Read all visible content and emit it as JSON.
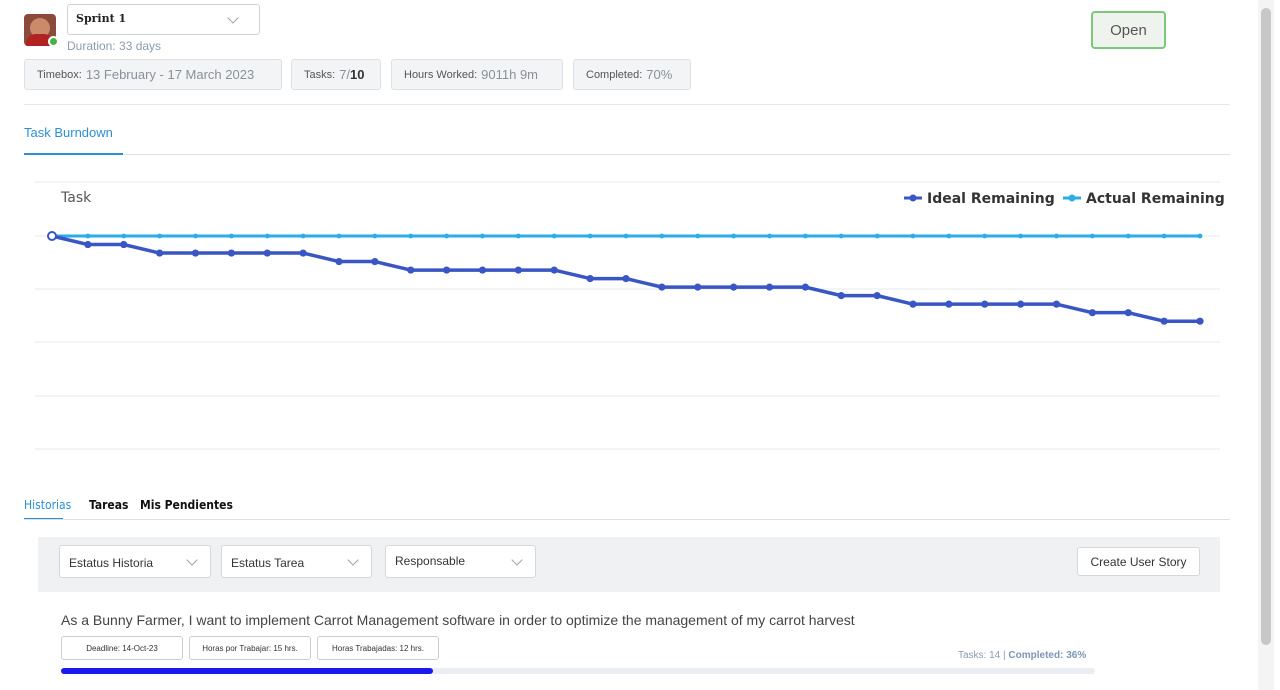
{
  "header": {
    "sprint_select_label": "Sprint 1",
    "duration": "Duration: 33 days",
    "status_button": "Open"
  },
  "stats": [
    {
      "key": "Timebox:",
      "value": "13 February - 17 March 2023"
    },
    {
      "key": "Tasks:",
      "value_prefix": "7/",
      "value_bold": "10"
    },
    {
      "key": "Hours Worked:",
      "value": "9011h 9m"
    },
    {
      "key": "Completed:",
      "value": "70%"
    }
  ],
  "tabs": {
    "burndown": "Task Burndown"
  },
  "chart_data": {
    "type": "line",
    "title": "Task",
    "legend_placement": "top-right",
    "grid": true,
    "x_count": 33,
    "ylim": [
      0,
      10
    ],
    "series": [
      {
        "name": "Ideal Remaining",
        "color": "#3a55c4",
        "values": [
          10,
          9.6,
          9.6,
          9.2,
          9.2,
          9.2,
          9.2,
          9.2,
          8.8,
          8.8,
          8.4,
          8.4,
          8.4,
          8.4,
          8.4,
          8.0,
          8.0,
          7.6,
          7.6,
          7.6,
          7.6,
          7.6,
          7.2,
          7.2,
          6.8,
          6.8,
          6.8,
          6.8,
          6.8,
          6.4,
          6.4,
          6.0,
          6.0
        ]
      },
      {
        "name": "Actual Remaining",
        "color": "#29aee6",
        "values": [
          10,
          10,
          10,
          10,
          10,
          10,
          10,
          10,
          10,
          10,
          10,
          10,
          10,
          10,
          10,
          10,
          10,
          10,
          10,
          10,
          10,
          10,
          10,
          10,
          10,
          10,
          10,
          10,
          10,
          10,
          10,
          10,
          10
        ]
      }
    ]
  },
  "bottom_tabs": {
    "historias": "Historias",
    "tareas": "Tareas",
    "pendientes": "Mis Pendientes"
  },
  "filters": {
    "estatus_historia": "Estatus Historia",
    "estatus_tarea": "Estatus Tarea",
    "responsable": "Responsable",
    "create_button": "Create User Story"
  },
  "story": {
    "title": "As a Bunny Farmer, I want to implement Carrot Management software in order to optimize the management of my carrot harvest",
    "deadline": "Deadline: 14-Oct-23",
    "horas_por_trabajar": "Horas por Trabajar: 15 hrs.",
    "horas_trabajadas": "Horas Trabajadas: 12 hrs.",
    "tasks": "Tasks: 14",
    "separator": "|",
    "completed": "Completed: 36%",
    "progress_fraction": 0.36
  },
  "colors": {
    "accent": "#2c8fd6",
    "open_border": "#7cc77c",
    "progress": "#1a1aee"
  }
}
